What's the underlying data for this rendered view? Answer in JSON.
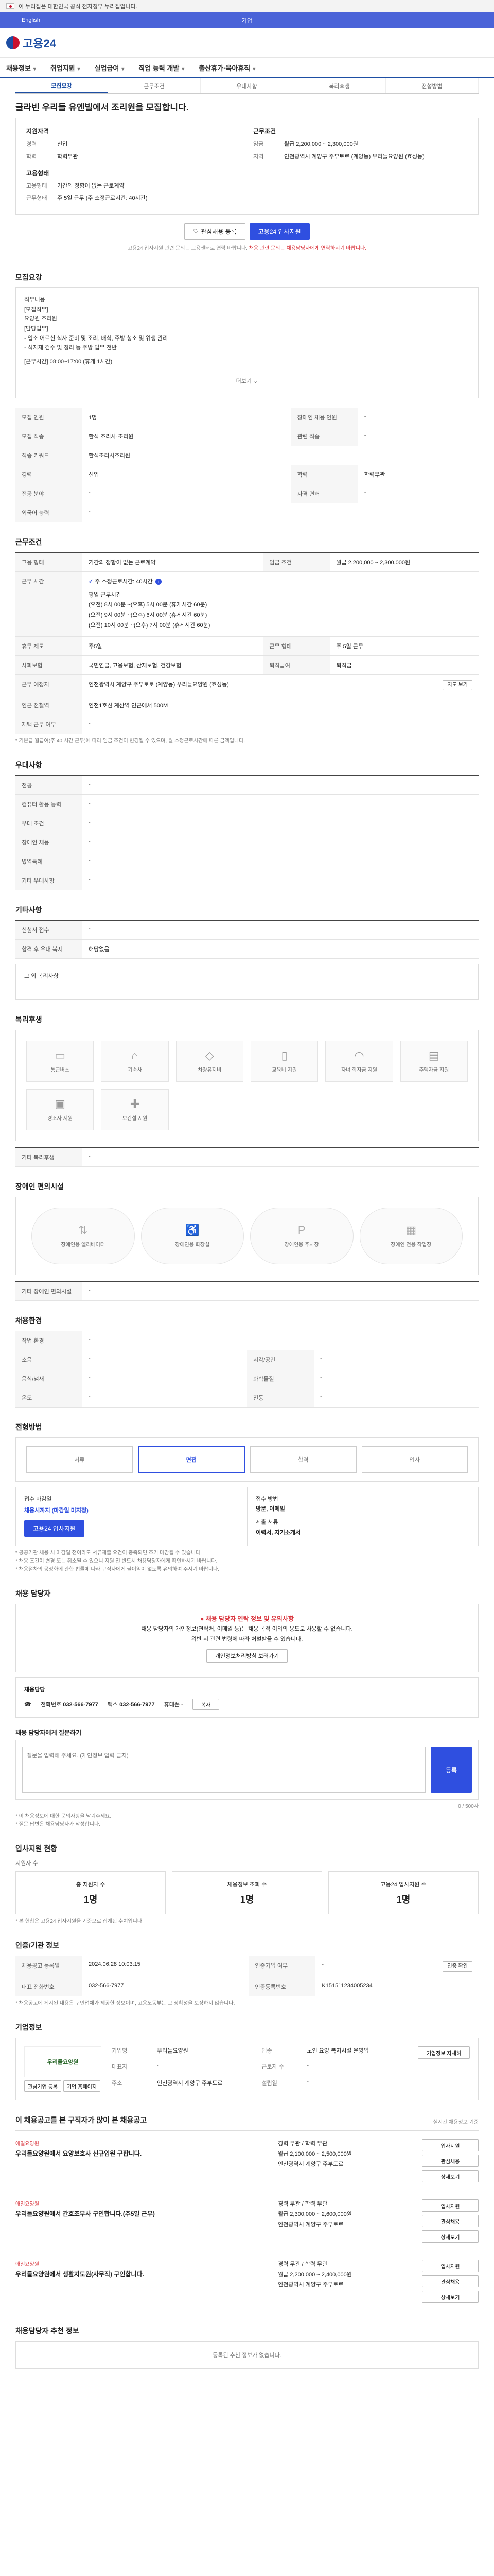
{
  "gov_banner": "이 누리집은 대한민국 공식 전자정부 누리집입니다.",
  "top_strip": {
    "lang": "English",
    "center": "기업"
  },
  "logo_text": "고용24",
  "gnb": [
    "채용정보",
    "취업지원",
    "실업급여",
    "직업 능력 개발",
    "출산휴가·육아휴직"
  ],
  "subtabs": [
    "모집요강",
    "근무조건",
    "우대사항",
    "복리후생",
    "전형방법"
  ],
  "job_title": "글라빈 우리들 유엔빌에서 조리원을 모집합니다.",
  "summary": {
    "left_head": "지원자격",
    "left_rows": [
      {
        "k": "경력",
        "v": "신입"
      },
      {
        "k": "학력",
        "v": "학력무관"
      }
    ],
    "left_head2": "고용형태",
    "left_rows2": [
      {
        "k": "고용형태",
        "v": "기간의 정함이 없는 근로계약"
      },
      {
        "k": "근무형태",
        "v": "주 5일 근무 (주 소정근로시간: 40시간)"
      }
    ],
    "right_head": "근무조건",
    "right_rows": [
      {
        "k": "임금",
        "v": "월급 2,200,000 ~ 2,300,000원"
      },
      {
        "k": "지역",
        "v": "인천광역시 계양구 주부토로 (계양동) 우리들요양원 (효성동)"
      }
    ]
  },
  "buttons": {
    "scrap": "관심채용 등록",
    "apply": "고용24 입사지원"
  },
  "note_center": "고용24 입사지원 관련 문의는 고용센터로 연락 바랍니다. ",
  "note_center_red": "채용 관련 문의는 채용담당자에게 연락하시기 바랍니다.",
  "sec1_title": "모집요강",
  "desc": [
    "직무내용",
    "[모집직무]",
    "요양원 조리원",
    "[담당업무]",
    "- 입소 어르신 식사 준비 및 조리, 배식, 주방 청소 및 위생 관리",
    "- 식자재 검수 및 정리 등 주방 업무 전반",
    "[근무시간] 08:00~17:00 (휴게 1시간)"
  ],
  "more_label": "더보기",
  "recruit_rows": [
    {
      "k": "모집 인원",
      "v": "1명",
      "k2": "장애인 채용 인원",
      "v2": "-"
    },
    {
      "k": "모집 직종",
      "v": "한식 조리사·조리원",
      "k2": "관련 직종",
      "v2": "-"
    },
    {
      "k": "직종 키워드",
      "v": "한식조리사조리원",
      "k2": "",
      "v2": ""
    },
    {
      "k": "경력",
      "v": "신입",
      "k2": "학력",
      "v2": "학력무관"
    },
    {
      "k": "전공 분야",
      "v": "-",
      "k2": "자격 면허",
      "v2": "-"
    },
    {
      "k": "외국어 능력",
      "v": "-",
      "k2": "",
      "v2": ""
    }
  ],
  "sec2_title": "근무조건",
  "cond": {
    "type_k": "고용 형태",
    "type_v": "기간의 정함이 없는 근로계약",
    "wage_k": "임금 조건",
    "wage_v": "월급 2,200,000 ~ 2,300,000원",
    "hours_k": "근무 시간",
    "hours_v": "주 소정근로시간: 40시간",
    "shift_lines": [
      "평일 근무시간",
      "(오전) 8시 00분 ~(오후) 5시 00분 (휴게시간 60분)",
      "(오전) 9시 00분 ~(오후) 6시 00분 (휴게시간 60분)",
      "(오전) 10시 00분 ~(오후) 7시 00분 (휴게시간 60분)"
    ],
    "rows": [
      {
        "k": "휴무 제도",
        "v": "주5일",
        "k2": "근무 형태",
        "v2": "주 5일 근무"
      },
      {
        "k": "사회보험",
        "v": "국민연금, 고용보험, 산재보험, 건강보험",
        "k2": "퇴직급여",
        "v2": "퇴직금"
      },
      {
        "k": "근무 예정지",
        "v": "인천광역시 계양구 주부토로 (계양동) 우리들요양원 (효성동)",
        "k2": "",
        "v2": ""
      },
      {
        "k": "인근 전철역",
        "v": "인천1호선 계산역 인근에서 500M",
        "k2": "",
        "v2": ""
      },
      {
        "k": "재택 근무 여부",
        "v": "-",
        "k2": "",
        "v2": ""
      }
    ],
    "map_btn": "지도 보기",
    "foot": "* 기본급 월급여(주 40 시간 근무)에 따라 임금 조건이 변경될 수 있으며, 월 소정근로시간에 따른 금액입니다."
  },
  "sec3_title": "우대사항",
  "pref_rows": [
    {
      "k": "전공",
      "v": "-"
    },
    {
      "k": "컴퓨터 활용 능력",
      "v": "-"
    },
    {
      "k": "우대 조건",
      "v": "-"
    },
    {
      "k": "장애인 채용",
      "v": "-"
    },
    {
      "k": "병역특례",
      "v": "-"
    },
    {
      "k": "기타 우대사항",
      "v": "-"
    }
  ],
  "sec4_title": "기타사항",
  "etc_rows": [
    {
      "k": "신청서 접수",
      "v": "-"
    },
    {
      "k": "합격 후 우대 복지",
      "v": "해당없음"
    }
  ],
  "etc_extra": "그 외 복리사항",
  "sec5_title": "복리후생",
  "welfare": [
    "통근버스",
    "기숙사",
    "차량유지비",
    "교육비 지원",
    "자녀 학자금 지원",
    "주택자금 지원",
    "경조사 지원",
    "보건설 지원"
  ],
  "welfare_extra_k": "기타 복리후생",
  "welfare_extra_v": "-",
  "sec6_title": "장애인 편의시설",
  "disabled": [
    "장애인용 엘리베이터",
    "장애인용 화장실",
    "장애인용 주차장",
    "장애인 전용 작업장"
  ],
  "disabled_extra_k": "기타 장애인 편의시설",
  "disabled_extra_v": "-",
  "sec7_title": "채용환경",
  "env_rows": [
    {
      "k": "작업 환경",
      "v": "-"
    },
    {
      "k": "소음",
      "v": "-",
      "k2": "시각/공간",
      "v2": "-"
    },
    {
      "k": "음식/냄새",
      "v": "-",
      "k2": "화학물질",
      "v2": "-"
    },
    {
      "k": "온도",
      "v": "-",
      "k2": "진동",
      "v2": "-"
    }
  ],
  "sec8_title": "전형방법",
  "steps": [
    "서류",
    "면접",
    "합격",
    "입사"
  ],
  "apply_info": {
    "left_k": "접수 마감일",
    "left_v": "채용시까지 (마감일 미지정)",
    "left_btn": "고용24 입사지원",
    "right_k": "접수 방법",
    "right_v": "방문, 이메일",
    "right_k2": "제출 서류",
    "right_v2": "이력서, 자기소개서"
  },
  "apply_foot": [
    "* 공공기관 채용 시 마감일 전이라도 서류제출 요건이 충족되면 조기 마감될 수 있습니다.",
    "* 채용 조건이 변경 또는 취소될 수 있으니 지원 전 반드시 채용담당자에게 확인하시기 바랍니다.",
    "* 채용절차의 공정화에 관한 법률에 따라 구직자에게 불이익이 없도록 유의하여 주시기 바랍니다."
  ],
  "sec9_title": "채용 담당자",
  "contact": {
    "warn": "채용 담당자 연락 정보 및 유의사항",
    "line1": "채용 담당자의 개인정보(연락처, 이메일 등)는 채용 목적 이외의 용도로 사용할 수 없습니다.",
    "line2": "위반 시 관련 법령에 따라 처벌받을 수 있습니다.",
    "btn": "개인정보처리방침 보러가기",
    "name_k": "채용담당",
    "phone_k": "전화번호",
    "phone_v": "032-566-7977",
    "fax_k": "팩스",
    "fax_v": "032-566-7977",
    "mobile_k": "휴대폰",
    "mobile_v": "-",
    "copy_btn": "복사"
  },
  "qa": {
    "label": "채용 담당자에게 질문하기",
    "placeholder": "질문을 입력해 주세요. (개인정보 입력 금지)",
    "counter": "0 / 500자",
    "btn": "등록",
    "foot1": "* 이 채용정보에 대한 문의사항을 남겨주세요.",
    "foot2": "* 질문 답변은 채용담당자가 작성합니다."
  },
  "sec10_title": "입사지원 현황",
  "sec10_sub": "지원자 수",
  "stats": [
    {
      "k": "총 지원자 수",
      "v": "1명"
    },
    {
      "k": "채용정보 조회 수",
      "v": "1명"
    },
    {
      "k": "고용24 입사지원 수",
      "v": "1명"
    }
  ],
  "stats_foot": "* 본 현황은 고용24 입사지원을 기준으로 집계된 수치입니다.",
  "sec11_title": "인증/기관 정보",
  "cert_rows": [
    {
      "k": "채용공고 등록일",
      "v": "2024.06.28 10:03:15",
      "k2": "인증기업 여부",
      "v2": "-"
    },
    {
      "k": "대표 전화번호",
      "v": "032-566-7977",
      "k2": "인증등록번호",
      "v2": "K151511234005234"
    }
  ],
  "cert_btn": "인증 확인",
  "cert_foot": "* 채용공고에 게시된 내용은 구인업체가 제공한 정보이며, 고용노동부는 그 정확성을 보장하지 않습니다.",
  "sec12_title": "기업정보",
  "company": {
    "logo": "우리들요양원",
    "btns": [
      "관심기업 등록",
      "기업 홈페이지"
    ],
    "rows": [
      {
        "k": "기업명",
        "v": "우리들요양원",
        "k2": "업종",
        "v2": "노인 요양 복지시설 운영업"
      },
      {
        "k": "대표자",
        "v": "-",
        "k2": "근로자 수",
        "v2": "-"
      },
      {
        "k": "주소",
        "v": "인천광역시 계양구 주부토로",
        "k2": "설립일",
        "v2": "-"
      }
    ],
    "detail_btn": "기업정보 자세히"
  },
  "sec13_title": "이 채용공고를 본 구직자가 많이 본 채용공고",
  "sec13_sub": "실시간 채용정보 기준",
  "recs": [
    {
      "company": "애일요양원",
      "title": "우리들요양원에서 요양보호사 신규입원 구합니다.",
      "lines": [
        "경력 무관 / 학력 무관",
        "월급 2,100,000 ~ 2,500,000원",
        "인천광역시 계양구 주부토로"
      ],
      "btns": [
        "입사지원",
        "관심채용",
        "상세보기"
      ]
    },
    {
      "company": "애일요양원",
      "title": "우리들요양원에서 간호조무사 구인합니다.(주5일 근무)",
      "lines": [
        "경력 무관 / 학력 무관",
        "월급 2,300,000 ~ 2,600,000원",
        "인천광역시 계양구 주부토로"
      ],
      "btns": [
        "입사지원",
        "관심채용",
        "상세보기"
      ]
    },
    {
      "company": "애일요양원",
      "title": "우리들요양원에서 생활지도원(사무직) 구인합니다.",
      "lines": [
        "경력 무관 / 학력 무관",
        "월급 2,200,000 ~ 2,400,000원",
        "인천광역시 계양구 주부토로"
      ],
      "btns": [
        "입사지원",
        "관심채용",
        "상세보기"
      ]
    }
  ],
  "sec14_title": "채용담당자 추천 정보",
  "empty_msg": "등록된 추천 정보가 없습니다."
}
